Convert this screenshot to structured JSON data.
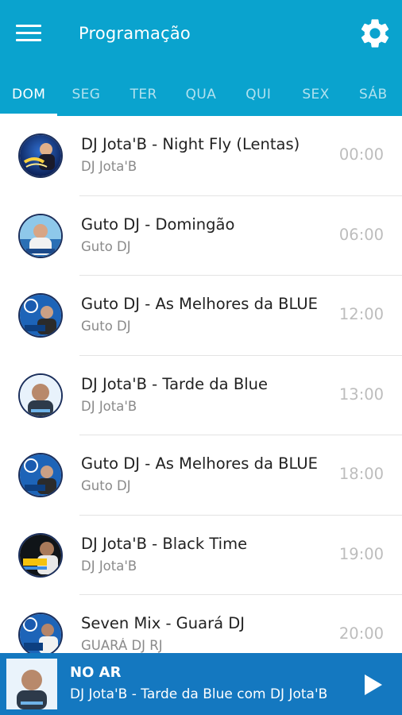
{
  "appbar": {
    "title": "Programação",
    "menu_icon": "hamburger-menu-icon",
    "settings_icon": "gear-icon",
    "color": "#0AA3CE"
  },
  "tabs": [
    {
      "label": "DOM",
      "active": true
    },
    {
      "label": "SEG",
      "active": false
    },
    {
      "label": "TER",
      "active": false
    },
    {
      "label": "QUA",
      "active": false
    },
    {
      "label": "QUI",
      "active": false
    },
    {
      "label": "SEX",
      "active": false
    },
    {
      "label": "SÁB",
      "active": false
    }
  ],
  "schedule": [
    {
      "title": "DJ Jota'B - Night Fly (Lentas)",
      "host": "DJ Jota'B",
      "time": "00:00",
      "avatar": "night-fly-logo"
    },
    {
      "title": "Guto DJ - Domingão",
      "host": "Guto DJ",
      "time": "06:00",
      "avatar": "guto-dj-photo"
    },
    {
      "title": "Guto DJ - As Melhores da BLUE",
      "host": "Guto DJ",
      "time": "12:00",
      "avatar": "blue-guto-dj-logo"
    },
    {
      "title": "DJ Jota'B - Tarde da Blue",
      "host": "DJ Jota'B",
      "time": "13:00",
      "avatar": "dj-jotab-photo"
    },
    {
      "title": "Guto DJ - As Melhores da BLUE",
      "host": "Guto DJ",
      "time": "18:00",
      "avatar": "blue-guto-dj-logo"
    },
    {
      "title": "DJ Jota'B - Black Time",
      "host": "DJ Jota'B",
      "time": "19:00",
      "avatar": "black-time-logo"
    },
    {
      "title": "Seven Mix - Guará DJ",
      "host": "GUARÁ DJ RJ",
      "time": "20:00",
      "avatar": "blue-guara-dj-logo"
    }
  ],
  "player": {
    "label": "NO AR",
    "track": "DJ Jota'B - Tarde da Blue com DJ Jota'B",
    "play_icon": "play-icon",
    "color": "#1478C0"
  }
}
